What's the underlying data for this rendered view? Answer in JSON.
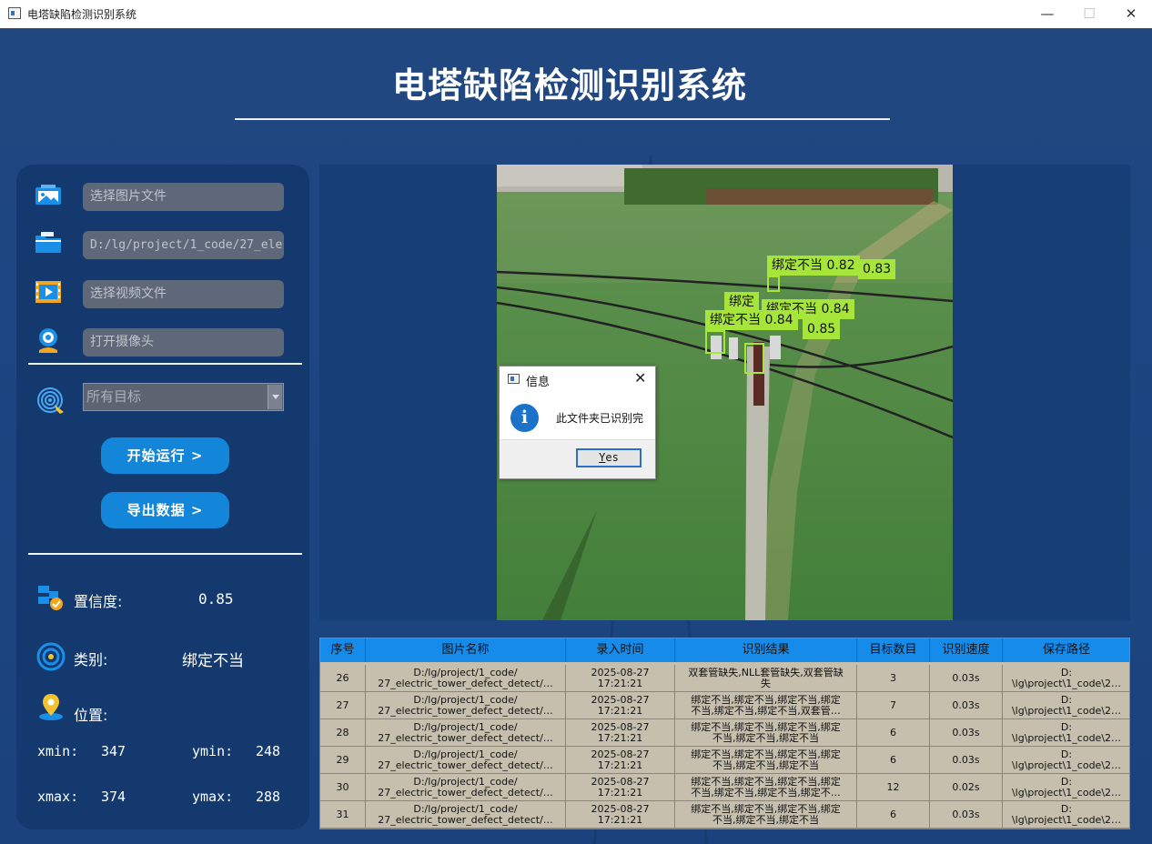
{
  "window": {
    "title": "电塔缺陷检测识别系统",
    "min": "—",
    "max": "☐",
    "close": "✕"
  },
  "header": {
    "title": "电塔缺陷检测识别系统"
  },
  "sidebar": {
    "image_field": {
      "placeholder": "选择图片文件",
      "icon": "image-icon"
    },
    "folder_field": {
      "value": "D:/lg/project/1_code/27_ele",
      "icon": "folder-icon"
    },
    "video_field": {
      "placeholder": "选择视频文件",
      "icon": "video-icon"
    },
    "camera_field": {
      "placeholder": "打开摄像头",
      "icon": "camera-icon"
    },
    "target_select": {
      "value": "所有目标",
      "icon": "target-icon"
    },
    "start_button": "开始运行 >",
    "export_button": "导出数据 >",
    "confidence": {
      "label": "置信度:",
      "value": "0.85"
    },
    "category": {
      "label": "类别:",
      "value": "绑定不当"
    },
    "position": {
      "label": "位置:",
      "xmin_label": "xmin:",
      "xmin": "347",
      "ymin_label": "ymin:",
      "ymin": "248",
      "xmax_label": "xmax:",
      "xmax": "374",
      "ymax_label": "ymax:",
      "ymax": "288"
    }
  },
  "detections": [
    {
      "label": "绑定不当 0.82"
    },
    {
      "label": "0.83"
    },
    {
      "label": "绑定"
    },
    {
      "label": "绑定不当 0.84"
    },
    {
      "label": "绑定不当 0.84"
    },
    {
      "label": "0.85"
    }
  ],
  "dialog": {
    "title": "信息",
    "message": "此文件夹已识别完",
    "ok": "Yes",
    "ok_mnemonic": "Y",
    "ok_rest": "es",
    "close": "✕",
    "icon_glyph": "i"
  },
  "table": {
    "headers": [
      "序号",
      "图片名称",
      "录入时间",
      "识别结果",
      "目标数目",
      "识别速度",
      "保存路径"
    ],
    "rows": [
      {
        "id": "26",
        "name1": "D:/lg/project/1_code/",
        "name2": "27_electric_tower_defect_detect/…",
        "date": "2025-08-27",
        "time": "17:21:21",
        "res1": "双套管缺失,NLL套管缺失,双套管缺",
        "res2": "失",
        "count": "3",
        "speed": "0.03s",
        "path1": "D:",
        "path2": "\\lg\\project\\1_code\\2…"
      },
      {
        "id": "27",
        "name1": "D:/lg/project/1_code/",
        "name2": "27_electric_tower_defect_detect/…",
        "date": "2025-08-27",
        "time": "17:21:21",
        "res1": "绑定不当,绑定不当,绑定不当,绑定",
        "res2": "不当,绑定不当,绑定不当,双套管…",
        "count": "7",
        "speed": "0.03s",
        "path1": "D:",
        "path2": "\\lg\\project\\1_code\\2…"
      },
      {
        "id": "28",
        "name1": "D:/lg/project/1_code/",
        "name2": "27_electric_tower_defect_detect/…",
        "date": "2025-08-27",
        "time": "17:21:21",
        "res1": "绑定不当,绑定不当,绑定不当,绑定",
        "res2": "不当,绑定不当,绑定不当",
        "count": "6",
        "speed": "0.03s",
        "path1": "D:",
        "path2": "\\lg\\project\\1_code\\2…"
      },
      {
        "id": "29",
        "name1": "D:/lg/project/1_code/",
        "name2": "27_electric_tower_defect_detect/…",
        "date": "2025-08-27",
        "time": "17:21:21",
        "res1": "绑定不当,绑定不当,绑定不当,绑定",
        "res2": "不当,绑定不当,绑定不当",
        "count": "6",
        "speed": "0.03s",
        "path1": "D:",
        "path2": "\\lg\\project\\1_code\\2…"
      },
      {
        "id": "30",
        "name1": "D:/lg/project/1_code/",
        "name2": "27_electric_tower_defect_detect/…",
        "date": "2025-08-27",
        "time": "17:21:21",
        "res1": "绑定不当,绑定不当,绑定不当,绑定",
        "res2": "不当,绑定不当,绑定不当,绑定不…",
        "count": "12",
        "speed": "0.02s",
        "path1": "D:",
        "path2": "\\lg\\project\\1_code\\2…"
      },
      {
        "id": "31",
        "name1": "D:/lg/project/1_code/",
        "name2": "27_electric_tower_defect_detect/…",
        "date": "2025-08-27",
        "time": "17:21:21",
        "res1": "绑定不当,绑定不当,绑定不当,绑定",
        "res2": "不当,绑定不当,绑定不当",
        "count": "6",
        "speed": "0.03s",
        "path1": "D:",
        "path2": "\\lg\\project\\1_code\\2…"
      }
    ]
  },
  "colors": {
    "accent": "#1486d9",
    "panel": "#13396f",
    "detection": "#a6e63a",
    "table_header": "#168bea"
  }
}
